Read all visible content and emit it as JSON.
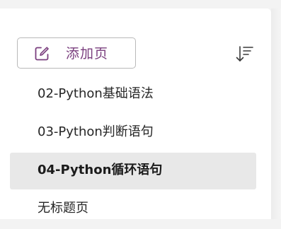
{
  "toolbar": {
    "add_page_label": "添加页",
    "add_page_icon": "new-page-icon",
    "sort_icon": "sort-descending-icon"
  },
  "pages": [
    {
      "title": "02-Python基础语法",
      "selected": false
    },
    {
      "title": "03-Python判断语句",
      "selected": false
    },
    {
      "title": "04-Python循环语句",
      "selected": true
    },
    {
      "title": "无标题页",
      "selected": false
    }
  ],
  "colors": {
    "accent": "#7a3e7e",
    "selected_bg": "#e8e8e8"
  }
}
